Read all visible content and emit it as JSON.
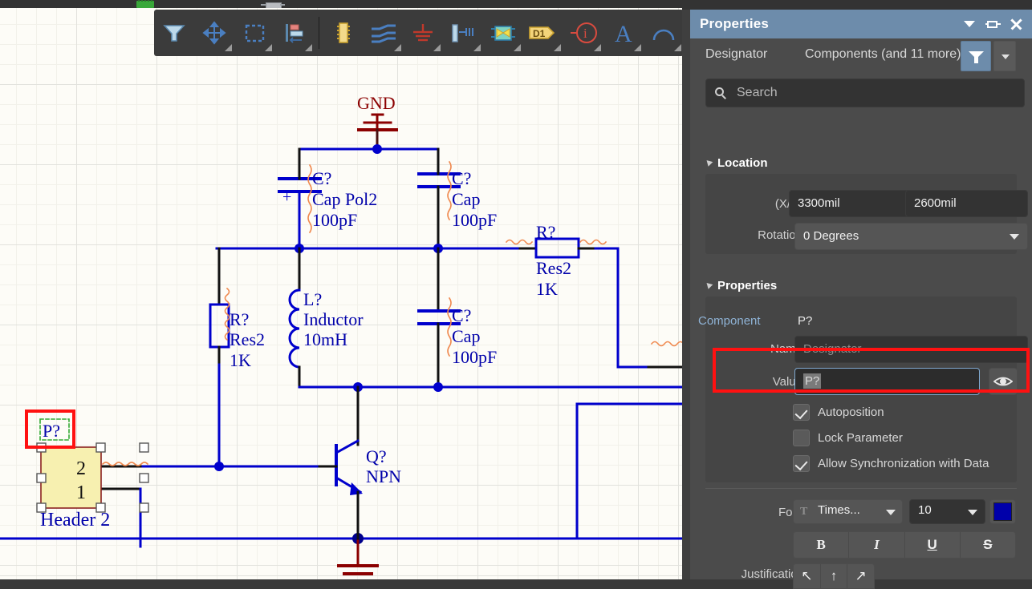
{
  "app": {
    "panel_title": "Properties"
  },
  "titlebar_icons": [
    {
      "name": "collapse-caret-icon",
      "glyph": "▼"
    },
    {
      "name": "pin-panel-icon",
      "glyph": "pin"
    },
    {
      "name": "close-panel-icon",
      "glyph": "✕"
    }
  ],
  "toolbar": {
    "buttons": [
      {
        "name": "filter-tool",
        "label": "Filter"
      },
      {
        "name": "move-tool",
        "label": "Move"
      },
      {
        "name": "area-select-tool",
        "label": "Area Select"
      },
      {
        "name": "align-tool",
        "label": "Align"
      },
      {
        "name": "place-part-tool",
        "label": "Place Part"
      },
      {
        "name": "place-wire-tool",
        "label": "Place Wire"
      },
      {
        "name": "place-gnd-tool",
        "label": "Place GND Power Port"
      },
      {
        "name": "place-bus-tool",
        "label": "Place Bus"
      },
      {
        "name": "place-sheet-symbol-tool",
        "label": "Place Sheet Symbol"
      },
      {
        "name": "place-designator-tool",
        "label": "D1"
      },
      {
        "name": "place-no-erc-tool",
        "label": "Place No ERC"
      },
      {
        "name": "place-text-tool",
        "label": "A"
      },
      {
        "name": "place-arc-tool",
        "label": "Place Arc"
      }
    ]
  },
  "panel": {
    "filter_row": {
      "scope_label": "Designator",
      "selection_label": "Components (and 11 more)",
      "filter_button": "filter-icon",
      "filter_dropdown": "chevron-down-icon"
    },
    "search": {
      "placeholder": "Search",
      "value": ""
    },
    "location": {
      "section_title": "Location",
      "xy_label": "(X/Y)",
      "x_value": "3300mil",
      "y_value": "2600mil",
      "rotation_label": "Rotation",
      "rotation_value": "0 Degrees"
    },
    "properties": {
      "section_title": "Properties",
      "component_label": "Component",
      "component_value": "P?",
      "name_label": "Name",
      "name_value": "Designator",
      "value_label": "Value",
      "value_value": "P?",
      "visibility_button": "eye-icon",
      "checkboxes": [
        {
          "label": "Autoposition",
          "checked": true
        },
        {
          "label": "Lock Parameter",
          "checked": false
        },
        {
          "label": "Allow Synchronization with Data",
          "checked": true
        }
      ],
      "font_label": "Font",
      "font_family": "Times...",
      "font_size": "10",
      "font_color": "#0000aa",
      "style_buttons": [
        {
          "name": "bold-button",
          "label": "B"
        },
        {
          "name": "italic-button",
          "label": "I"
        },
        {
          "name": "underline-button",
          "label": "U"
        },
        {
          "name": "strikethrough-button",
          "label": "S"
        }
      ],
      "justification_label": "Justification",
      "justification_buttons": [
        {
          "name": "justify-top-left-button",
          "label": "↖"
        },
        {
          "name": "justify-top-center-button",
          "label": "↑"
        },
        {
          "name": "justify-top-right-button",
          "label": "↗"
        }
      ]
    }
  },
  "schematic": {
    "components": [
      {
        "name": "gnd-top",
        "designator": "GND",
        "type": "power-port"
      },
      {
        "name": "cap-pol",
        "designator": "C?",
        "part": "Cap Pol2",
        "value": "100pF"
      },
      {
        "name": "cap-top-right",
        "designator": "C?",
        "part": "Cap",
        "value": "100pF"
      },
      {
        "name": "cap-mid",
        "designator": "C?",
        "part": "Cap",
        "value": "100pF"
      },
      {
        "name": "res-left",
        "designator": "R?",
        "part": "Res2",
        "value": "1K"
      },
      {
        "name": "res-right",
        "designator": "R?",
        "part": "Res2",
        "value": "1K"
      },
      {
        "name": "inductor",
        "designator": "L?",
        "part": "Inductor",
        "value": "10mH"
      },
      {
        "name": "transistor",
        "designator": "Q?",
        "part": "NPN"
      },
      {
        "name": "header",
        "designator": "P?",
        "part": "Header 2",
        "pins": [
          "2",
          "1"
        ]
      }
    ],
    "colors": {
      "wire": "#0000cc",
      "gnd": "#8b0000",
      "component_body": "#f5f0a8",
      "component_outline": "#8b2020",
      "selection_handle": "#ffffff",
      "designator_highlight": "#33aa33",
      "annotation": "#ff1111"
    }
  }
}
